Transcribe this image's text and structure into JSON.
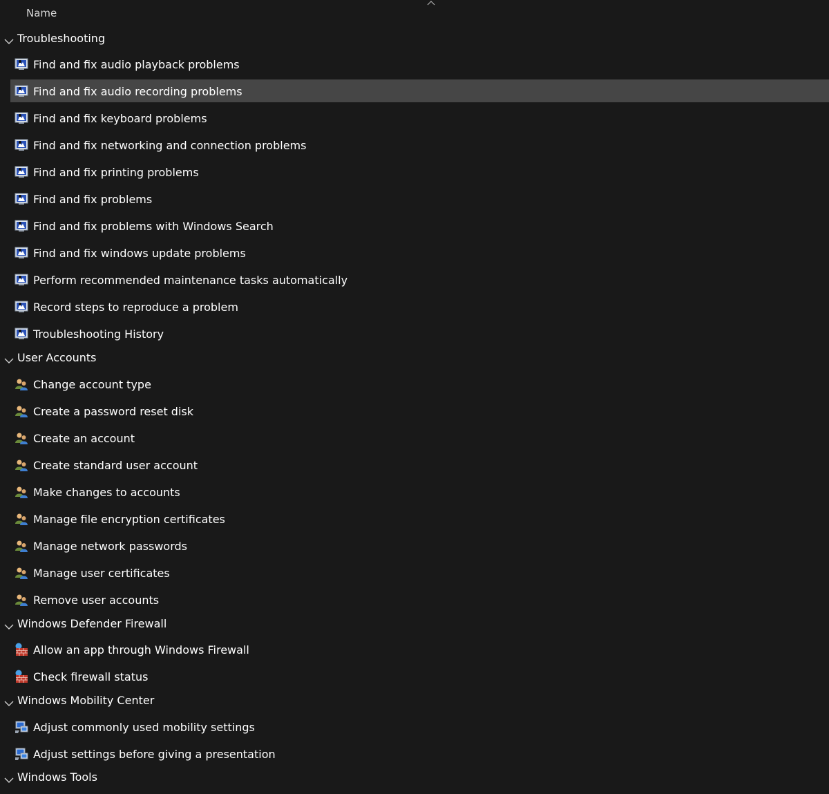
{
  "header": {
    "name_label": "Name"
  },
  "groups": [
    {
      "label": "Troubleshooting",
      "icon": "troubleshoot-icon",
      "items": [
        "Find and fix audio playback problems",
        "Find and fix audio recording problems",
        "Find and fix keyboard problems",
        "Find and fix networking and connection problems",
        "Find and fix printing problems",
        "Find and fix problems",
        "Find and fix problems with Windows Search",
        "Find and fix windows update problems",
        "Perform recommended maintenance tasks automatically",
        "Record steps to reproduce a problem",
        "Troubleshooting History"
      ]
    },
    {
      "label": "User Accounts",
      "icon": "users-icon",
      "items": [
        "Change account type",
        "Create a password reset disk",
        "Create an account",
        "Create standard user account",
        "Make changes to accounts",
        "Manage file encryption certificates",
        "Manage network passwords",
        "Manage user certificates",
        "Remove user accounts"
      ]
    },
    {
      "label": "Windows Defender Firewall",
      "icon": "firewall-icon",
      "items": [
        "Allow an app through Windows Firewall",
        "Check firewall status"
      ]
    },
    {
      "label": "Windows Mobility Center",
      "icon": "mobility-icon",
      "items": [
        "Adjust commonly used mobility settings",
        "Adjust settings before giving a presentation"
      ]
    },
    {
      "label": "Windows Tools",
      "icon": "",
      "items": []
    }
  ],
  "selected_item": "Find and fix audio recording problems",
  "colors": {
    "background": "#191919",
    "selection": "#464646",
    "text": "#ffffff"
  }
}
